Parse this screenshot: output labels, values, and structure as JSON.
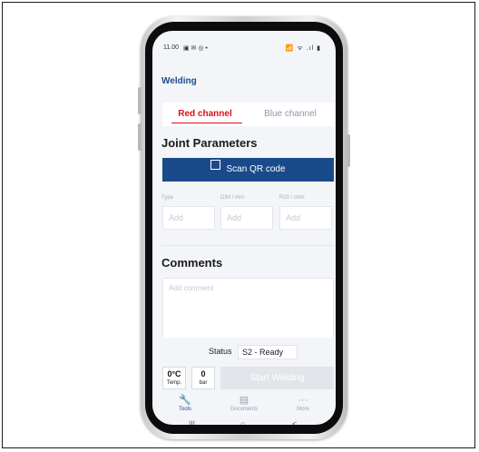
{
  "status_bar": {
    "time": "11.00",
    "left_icons": "▣ ✉ ◎ •",
    "right_icons": "📶 ᯤ .ıl ▮"
  },
  "app": {
    "title": "Welding"
  },
  "channel_tabs": {
    "red": "Red channel",
    "blue": "Blue channel",
    "selected": "Red channel"
  },
  "joint": {
    "title": "Joint Parameters",
    "scan_button": "Scan QR code",
    "fields": [
      {
        "label": "Type",
        "placeholder": "Add"
      },
      {
        "label": "DIM / mm",
        "placeholder": "Add"
      },
      {
        "label": "R20 / ohm",
        "placeholder": "Add"
      }
    ]
  },
  "comments": {
    "title": "Comments",
    "placeholder": "Add comment"
  },
  "status": {
    "label": "Status",
    "value": "S2 - Ready"
  },
  "readings": {
    "temp": {
      "value": "0°C",
      "unit": "Temp."
    },
    "pressure": {
      "value": "0",
      "unit": "bar"
    }
  },
  "start_button": "Start Welding",
  "bottom_nav": [
    {
      "label": "Tools",
      "icon": "wrench-icon",
      "glyph": "🔧",
      "active": true
    },
    {
      "label": "Documents",
      "icon": "document-icon",
      "glyph": "▤",
      "active": false
    },
    {
      "label": "More",
      "icon": "more-icon",
      "glyph": "···",
      "active": false
    }
  ],
  "system_nav": {
    "recent": "|||",
    "home": "○",
    "back": "<"
  },
  "colors": {
    "brand_blue": "#1a4a8a",
    "accent_red": "#d9121b",
    "disabled_gray": "#e2e5e9"
  }
}
